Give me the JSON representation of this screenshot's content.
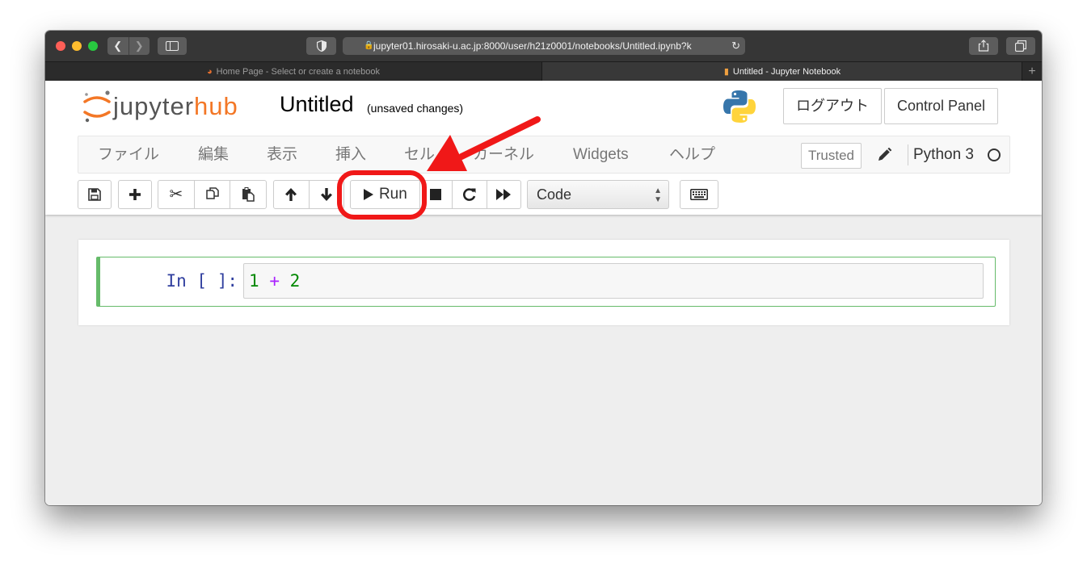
{
  "browser": {
    "url": "jupyter01.hirosaki-u.ac.jp:8000/user/h21z0001/notebooks/Untitled.ipynb?k",
    "tabs": [
      {
        "label": "Home Page - Select or create a notebook",
        "active": false
      },
      {
        "label": "Untitled - Jupyter Notebook",
        "active": true
      }
    ]
  },
  "header": {
    "logo_part1": "jupyter",
    "logo_part2": "hub",
    "notebook_title": "Untitled",
    "save_status": "(unsaved changes)",
    "logout_label": "ログアウト",
    "control_panel_label": "Control Panel"
  },
  "menubar": {
    "items": [
      "ファイル",
      "編集",
      "表示",
      "挿入",
      "セル",
      "カーネル",
      "Widgets",
      "ヘルプ"
    ],
    "trusted_label": "Trusted",
    "kernel_name": "Python 3"
  },
  "toolbar": {
    "run_label": "Run",
    "cell_type": "Code"
  },
  "cell": {
    "prompt": "In [ ]:",
    "code_tokens": [
      "1",
      "+",
      "2"
    ]
  },
  "colors": {
    "jupyter_orange": "#f37726",
    "annotation_red": "#f01818",
    "cell_border_green": "#66bb6a",
    "prompt_blue": "#303f9f"
  }
}
